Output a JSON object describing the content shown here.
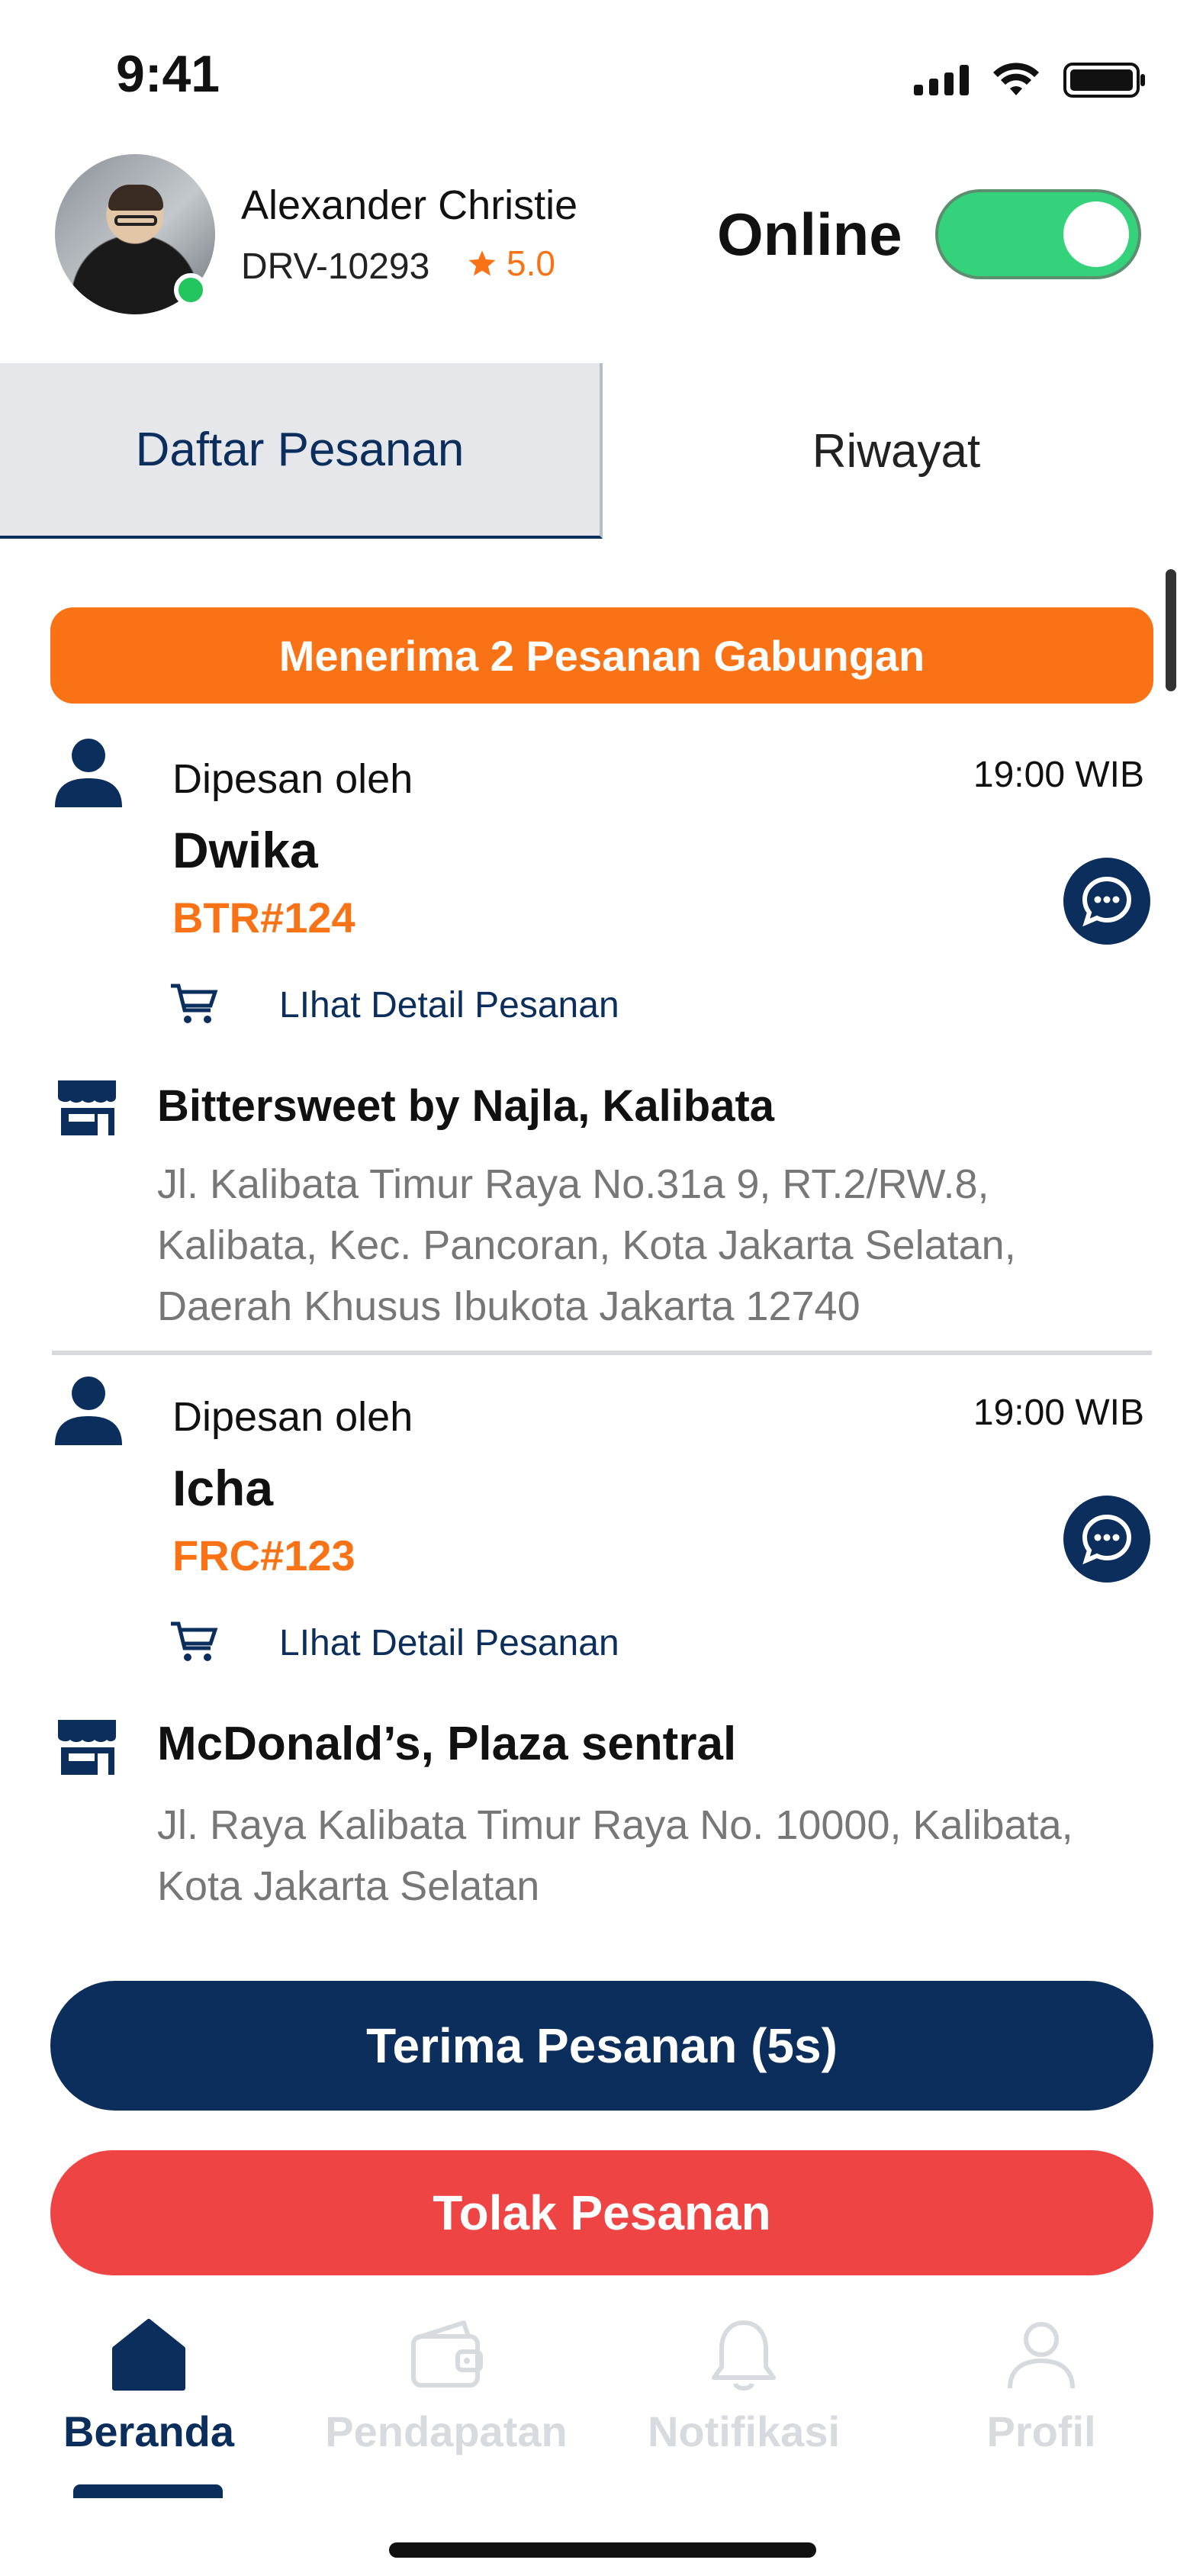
{
  "status_bar": {
    "time": "9:41"
  },
  "driver": {
    "name": "Alexander Christie",
    "id": "DRV-10293",
    "rating": "5.0"
  },
  "online_label": "Online",
  "online_toggle_on": true,
  "tabs": [
    {
      "label": "Daftar Pesanan",
      "active": true
    },
    {
      "label": "Riwayat",
      "active": false
    }
  ],
  "banner": "Menerima 2 Pesanan Gabungan",
  "orders": [
    {
      "ordered_by_label": "Dipesan oleh",
      "time": "19:00 WIB",
      "customer": "Dwika",
      "code": "BTR#124",
      "detail_link": "LIhat Detail Pesanan",
      "store": "Bittersweet by Najla, Kalibata",
      "address": "Jl. Kalibata Timur Raya No.31a 9, RT.2/RW.8, Kalibata, Kec. Pancoran, Kota Jakarta Selatan, Daerah Khusus Ibukota Jakarta 12740"
    },
    {
      "ordered_by_label": "Dipesan oleh",
      "time": "19:00 WIB",
      "customer": "Icha",
      "code": "FRC#123",
      "detail_link": "LIhat Detail Pesanan",
      "store": "McDonald’s, Plaza sentral",
      "address": "Jl. Raya Kalibata Timur Raya No. 10000, Kalibata, Kota Jakarta Selatan"
    }
  ],
  "actions": {
    "accept": "Terima Pesanan (5s)",
    "reject": "Tolak Pesanan"
  },
  "nav": [
    {
      "label": "Beranda",
      "icon": "home-icon",
      "active": true
    },
    {
      "label": "Pendapatan",
      "icon": "wallet-icon",
      "active": false
    },
    {
      "label": "Notifikasi",
      "icon": "bell-icon",
      "active": false
    },
    {
      "label": "Profil",
      "icon": "user-icon",
      "active": false
    }
  ],
  "colors": {
    "primary": "#0b2e5c",
    "accent": "#f97316",
    "danger": "#ef4444",
    "online": "#34d27b"
  }
}
